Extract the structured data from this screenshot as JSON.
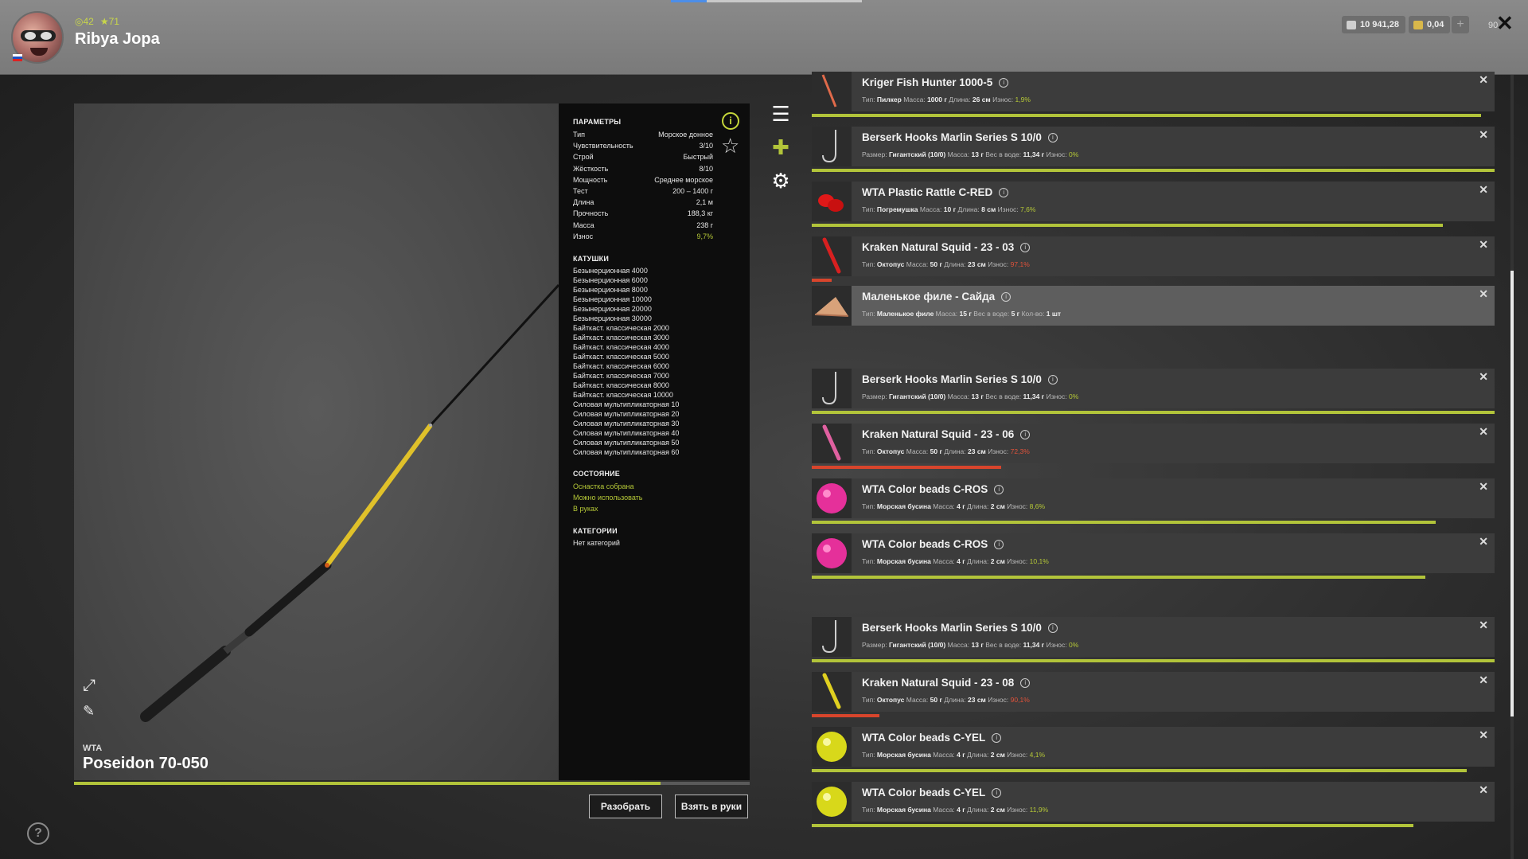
{
  "player": {
    "name": "Ribya Jopa",
    "level": "42",
    "stars": "71",
    "level_icon": "level-ring-icon",
    "star_icon": "star-icon"
  },
  "wallet": {
    "silver": "10 941,28",
    "gold": "0,04"
  },
  "counter": "90",
  "rod": {
    "brand": "WTA",
    "name": "Poseidon 70-050"
  },
  "params": {
    "title": "ПАРАМЕТРЫ",
    "rows": [
      {
        "k": "Тип",
        "v": "Морское донное"
      },
      {
        "k": "Чувствительность",
        "v": "3/10"
      },
      {
        "k": "Строй",
        "v": "Быстрый"
      },
      {
        "k": "Жёсткость",
        "v": "8/10"
      },
      {
        "k": "Мощность",
        "v": "Среднее морское"
      },
      {
        "k": "Тест",
        "v": "200 – 1400 г"
      },
      {
        "k": "Длина",
        "v": "2,1 м"
      },
      {
        "k": "Прочность",
        "v": "188,3 кг"
      },
      {
        "k": "Масса",
        "v": "238 г"
      },
      {
        "k": "Износ",
        "v": "9,7%"
      }
    ]
  },
  "reels": {
    "title": "КАТУШКИ",
    "items": [
      "Безынерционная 4000",
      "Безынерционная 6000",
      "Безынерционная 8000",
      "Безынерционная 10000",
      "Безынерционная 20000",
      "Безынерционная 30000",
      "Байткаст. классическая 2000",
      "Байткаст. классическая 3000",
      "Байткаст. классическая 4000",
      "Байткаст. классическая 5000",
      "Байткаст. классическая 6000",
      "Байткаст. классическая 7000",
      "Байткаст. классическая 8000",
      "Байткаст. классическая 10000",
      "Силовая мультипликаторная 10",
      "Силовая мультипликаторная 20",
      "Силовая мультипликаторная 30",
      "Силовая мультипликаторная 40",
      "Силовая мультипликаторная 50",
      "Силовая мультипликаторная 60"
    ]
  },
  "state": {
    "title": "СОСТОЯНИЕ",
    "items": [
      "Оснастка собрана",
      "Можно использовать",
      "В руках"
    ]
  },
  "categories": {
    "title": "КАТЕГОРИИ",
    "value": "Нет категорий"
  },
  "rod_wear_progress": 0.868,
  "buttons": {
    "disassemble": "Разобрать",
    "take": "Взять в руки"
  },
  "list": [
    {
      "name": "Kriger Fish Hunter 1000-5",
      "sub": [
        [
          "Тип:",
          "Пилкер"
        ],
        [
          "Масса:",
          "1000 г"
        ],
        [
          "Длина:",
          "26 см"
        ]
      ],
      "wear_label": "Износ:",
      "wear": "1,9%",
      "bar": 0.98,
      "icon": "pilker-icon"
    },
    {
      "name": "Berserk Hooks Marlin Series S 10/0",
      "sub": [
        [
          "Размер:",
          "Гигантский (10/0)"
        ],
        [
          "Масса:",
          "13 г"
        ],
        [
          "Вес в воде:",
          "11,34 г"
        ]
      ],
      "wear_label": "Износ:",
      "wear": "0%",
      "bar": 1.0,
      "icon": "hook-icon"
    },
    {
      "name": "WTA Plastic Rattle C-RED",
      "sub": [
        [
          "Тип:",
          "Погремушка"
        ],
        [
          "Масса:",
          "10 г"
        ],
        [
          "Длина:",
          "8 см"
        ]
      ],
      "wear_label": "Износ:",
      "wear": "7,6%",
      "bar": 0.924,
      "icon": "rattle-icon"
    },
    {
      "name": "Kraken Natural Squid - 23 - 03",
      "sub": [
        [
          "Тип:",
          "Октопус"
        ],
        [
          "Масса:",
          "50 г"
        ],
        [
          "Длина:",
          "23 см"
        ]
      ],
      "wear_label": "Износ:",
      "wear": "97,1%",
      "bar": 0.029,
      "red": true,
      "icon": "squid-red-icon"
    },
    {
      "name": "Маленькое филе - Сайда",
      "sub": [
        [
          "Тип:",
          "Маленькое филе"
        ],
        [
          "Масса:",
          "15 г"
        ],
        [
          "Вес в воде:",
          "5 г"
        ],
        [
          "Кол-во:",
          "1 шт"
        ]
      ],
      "highlight": true,
      "icon": "fillet-icon"
    },
    {
      "name": "Berserk Hooks Marlin Series S 10/0",
      "sub": [
        [
          "Размер:",
          "Гигантский (10/0)"
        ],
        [
          "Масса:",
          "13 г"
        ],
        [
          "Вес в воде:",
          "11,34 г"
        ]
      ],
      "wear_label": "Износ:",
      "wear": "0%",
      "bar": 1.0,
      "icon": "hook-icon"
    },
    {
      "name": "Kraken Natural Squid - 23 - 06",
      "sub": [
        [
          "Тип:",
          "Октопус"
        ],
        [
          "Масса:",
          "50 г"
        ],
        [
          "Длина:",
          "23 см"
        ]
      ],
      "wear_label": "Износ:",
      "wear": "72,3%",
      "bar": 0.277,
      "red": true,
      "icon": "squid-pink-icon"
    },
    {
      "name": "WTA Color beads C-ROS",
      "sub": [
        [
          "Тип:",
          "Морская бусина"
        ],
        [
          "Масса:",
          "4 г"
        ],
        [
          "Длина:",
          "2 см"
        ]
      ],
      "wear_label": "Износ:",
      "wear": "8,6%",
      "bar": 0.914,
      "icon": "bead-pink-icon"
    },
    {
      "name": "WTA Color beads C-ROS",
      "sub": [
        [
          "Тип:",
          "Морская бусина"
        ],
        [
          "Масса:",
          "4 г"
        ],
        [
          "Длина:",
          "2 см"
        ]
      ],
      "wear_label": "Износ:",
      "wear": "10,1%",
      "bar": 0.899,
      "icon": "bead-pink-icon"
    },
    {
      "name": "Berserk Hooks Marlin Series S 10/0",
      "sub": [
        [
          "Размер:",
          "Гигантский (10/0)"
        ],
        [
          "Масса:",
          "13 г"
        ],
        [
          "Вес в воде:",
          "11,34 г"
        ]
      ],
      "wear_label": "Износ:",
      "wear": "0%",
      "bar": 1.0,
      "icon": "hook-icon"
    },
    {
      "name": "Kraken Natural Squid - 23 - 08",
      "sub": [
        [
          "Тип:",
          "Октопус"
        ],
        [
          "Масса:",
          "50 г"
        ],
        [
          "Длина:",
          "23 см"
        ]
      ],
      "wear_label": "Износ:",
      "wear": "90,1%",
      "bar": 0.099,
      "red": true,
      "icon": "squid-yellow-icon"
    },
    {
      "name": "WTA Color beads C-YEL",
      "sub": [
        [
          "Тип:",
          "Морская бусина"
        ],
        [
          "Масса:",
          "4 г"
        ],
        [
          "Длина:",
          "2 см"
        ]
      ],
      "wear_label": "Износ:",
      "wear": "4,1%",
      "bar": 0.959,
      "icon": "bead-yellow-icon"
    },
    {
      "name": "WTA Color beads C-YEL",
      "sub": [
        [
          "Тип:",
          "Морская бусина"
        ],
        [
          "Масса:",
          "4 г"
        ],
        [
          "Длина:",
          "2 см"
        ]
      ],
      "wear_label": "Износ:",
      "wear": "11,9%",
      "bar": 0.881,
      "icon": "bead-yellow-icon"
    }
  ],
  "colors": {
    "accent": "#b2c43a",
    "wear_red": "#d8452c",
    "panel_bg": "#0d0d0d",
    "row_bg": "#3c3c3c",
    "row_highlight": "#5e5e5e"
  }
}
